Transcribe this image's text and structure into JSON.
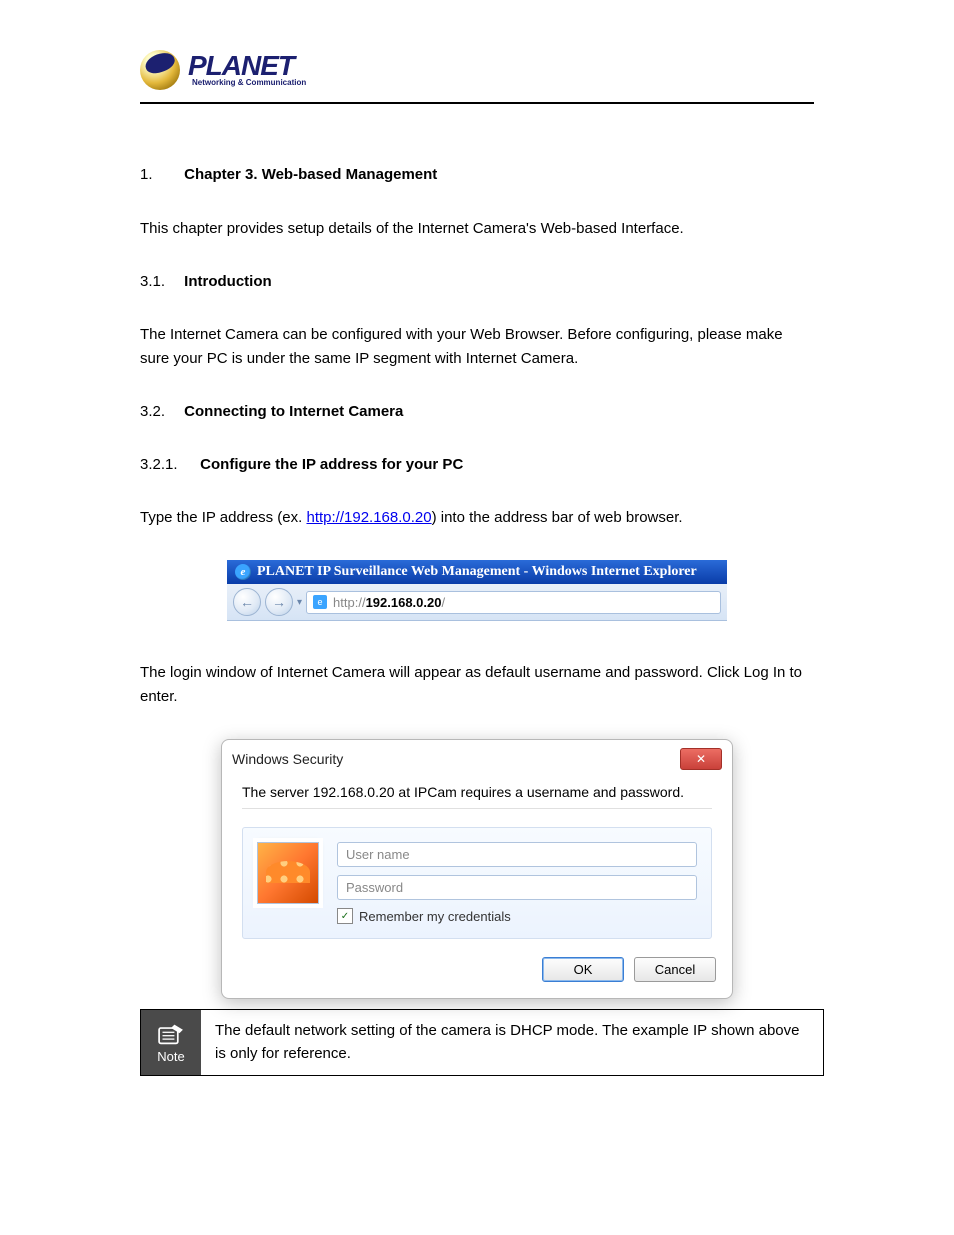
{
  "header": {
    "brand": "PLANET",
    "tagline": "Networking & Communication"
  },
  "chapter": {
    "number": "1.",
    "title": "Chapter 3. Web-based Management"
  },
  "intro": "This chapter provides setup details of the Internet Camera's Web-based Interface.",
  "section_31": {
    "number": "3.1.",
    "title": "Introduction"
  },
  "intro2": "The Internet Camera can be configured with your Web Browser. Before configuring, please make sure your PC is under the same IP segment with Internet Camera.",
  "section_32": {
    "number": "3.2.",
    "title": "Connecting to Internet Camera"
  },
  "sub_321": {
    "number": "3.2.1.",
    "title": "Configure the IP address for your PC"
  },
  "addr_text_prefix": "Type the IP address (ex. ",
  "addr_link": "http://192.168.0.20",
  "addr_text_suffix": ") into the address bar of web browser.",
  "browser": {
    "title": "PLANET IP Surveillance Web Management - Windows Internet Explorer",
    "url_plain": "http://",
    "url_bold": "192.168.0.20",
    "url_tail": "/"
  },
  "login_prompt": "The login window of Internet Camera will appear as default username and password. Click Log In to enter.",
  "dialog": {
    "title": "Windows Security",
    "message": "The server 192.168.0.20 at IPCam requires a username and password.",
    "user_placeholder": "User name",
    "pass_placeholder": "Password",
    "remember": "Remember my credentials",
    "ok": "OK",
    "cancel": "Cancel"
  },
  "note": {
    "label": "Note",
    "text": "The default network setting of the camera is DHCP mode. The example IP shown above is only for reference."
  }
}
